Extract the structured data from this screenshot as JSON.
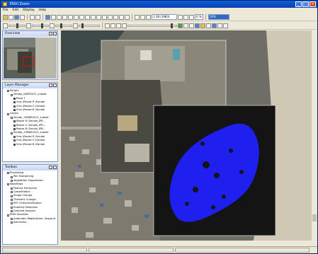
{
  "window": {
    "title": "ENVI Zoom"
  },
  "menu": [
    "File",
    "Edit",
    "Display",
    "Help"
  ],
  "toolbar": {
    "zoom_value": "1:38 (1983)",
    "zoom_percent": "0 %",
    "stretch_value": "50%"
  },
  "overview": {
    "title": "Overview"
  },
  "layer_manager": {
    "title": "Layer Manager",
    "items": [
      {
        "label": "Portals",
        "level": 0
      },
      {
        "label": "Sendai_AAPR2011_subset",
        "level": 1
      },
      {
        "label": "Band 1",
        "level": 2,
        "color": "#000000"
      },
      {
        "label": "Vrss (Resize R (Sendai",
        "level": 2,
        "color": "#cc0000"
      },
      {
        "label": "Vrss (Resize G (Sendai",
        "level": 2,
        "color": "#00aa00"
      },
      {
        "label": "Vrss (Resize B (Sendai",
        "level": 2,
        "color": "#0000cc"
      },
      {
        "label": "Layers",
        "level": 0
      },
      {
        "label": "Sendai_13MAR2011_subset",
        "level": 1
      },
      {
        "label": "Resize R (Sendai_IPR...",
        "level": 2,
        "color": "#cc0000"
      },
      {
        "label": "Resize G (Sendai_IPR...",
        "level": 2,
        "color": "#00aa00"
      },
      {
        "label": "Resize B (Sendai_IPR...",
        "level": 2,
        "color": "#0000cc"
      },
      {
        "label": "Sendai_13MAR2011_subset",
        "level": 1
      },
      {
        "label": "Vrss (Resize R (Sendai",
        "level": 2,
        "color": "#cc0000"
      },
      {
        "label": "Vrss (Resize G (Sendai",
        "level": 2,
        "color": "#00aa00"
      },
      {
        "label": "Vrss (Resize B (Sendai",
        "level": 2,
        "color": "#0000cc"
      }
    ]
  },
  "toolbox": {
    "title": "Toolbox",
    "items": [
      {
        "label": "Processing",
        "level": 0
      },
      {
        "label": "Pan Sharpening",
        "level": 1
      },
      {
        "label": "Vegetation Suppression",
        "level": 1
      },
      {
        "label": "Workflows",
        "level": 0
      },
      {
        "label": "Feature Extraction",
        "level": 1
      },
      {
        "label": "Classification",
        "level": 1
      },
      {
        "label": "Image Change",
        "level": 1
      },
      {
        "label": "Thematic Change",
        "level": 1
      },
      {
        "label": "RPC Orthorectification",
        "level": 1
      },
      {
        "label": "Anomaly Detection",
        "level": 1
      },
      {
        "label": "Directed Analysis",
        "level": 1
      },
      {
        "label": "ENVI Favorites",
        "level": 0
      },
      {
        "label": "Automatic Registration: Image to",
        "level": 1
      },
      {
        "label": "Add Items...",
        "level": 1
      }
    ]
  },
  "colors": {
    "titlebar": "#0a4fc8",
    "water_detection": "#1a1aff"
  }
}
